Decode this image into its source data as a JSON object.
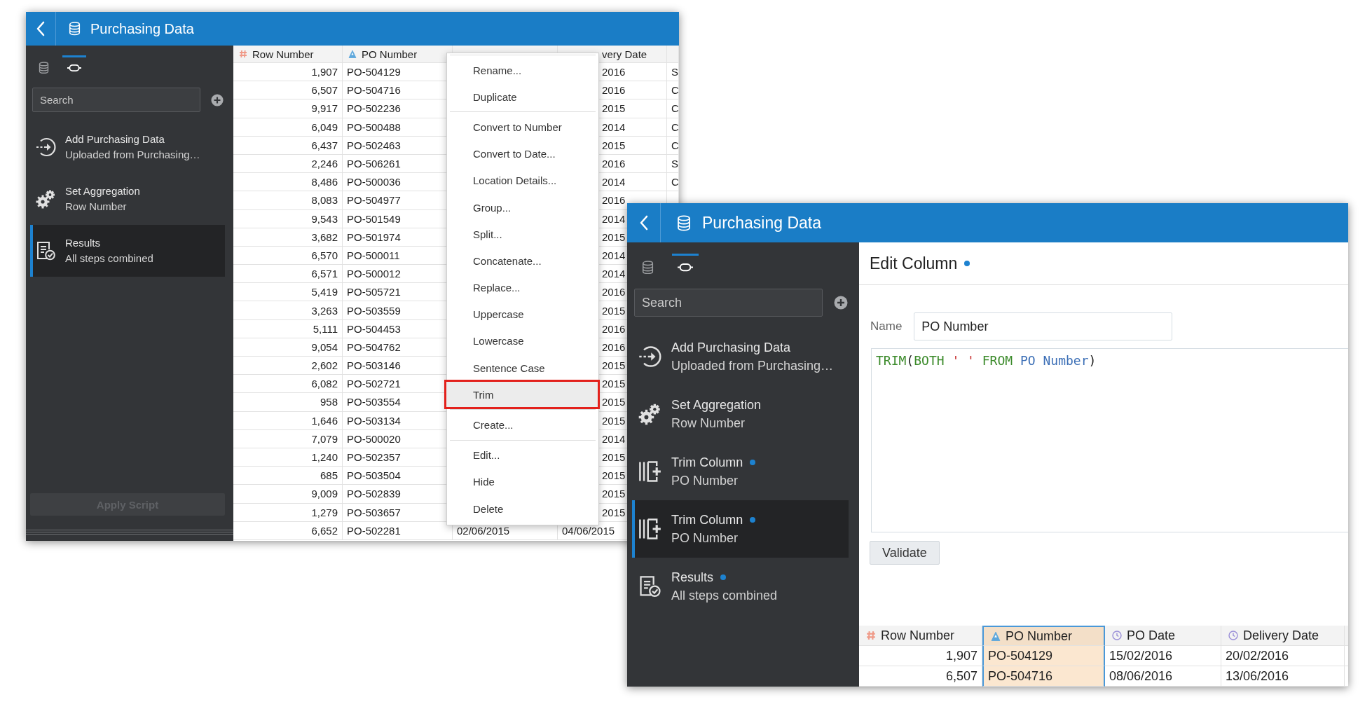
{
  "windows": [
    {
      "title": "Purchasing Data",
      "sidebar": {
        "tabs": [
          {
            "kind": "sources",
            "selected": false
          },
          {
            "kind": "script",
            "selected": true
          }
        ],
        "search": {
          "placeholder": "Search"
        },
        "steps": [
          {
            "kind": "add",
            "title": "Add Purchasing Data",
            "subtitle": "Uploaded from Purchasing…",
            "selected": false,
            "unsaved": false
          },
          {
            "kind": "aggregate",
            "title": "Set Aggregation",
            "subtitle": "Row Number",
            "selected": false,
            "unsaved": false
          },
          {
            "kind": "results",
            "title": "Results",
            "subtitle": "All steps combined",
            "selected": true,
            "unsaved": false
          }
        ],
        "apply_button": {
          "label": "Apply Script",
          "disabled": true
        }
      },
      "table": {
        "columns": [
          {
            "label": "Row Number",
            "kind": "number",
            "selected": false
          },
          {
            "label": "PO Number",
            "kind": "text",
            "selected": false
          },
          {
            "label": "very Date",
            "covered": true,
            "selected": false
          }
        ],
        "rows": [
          {
            "row_number": "1,907",
            "po_number": "PO-504129",
            "delivery_date": "2016",
            "column_5": "S",
            "covered": true
          },
          {
            "row_number": "6,507",
            "po_number": "PO-504716",
            "delivery_date": "2016",
            "column_5": "C",
            "covered": true
          },
          {
            "row_number": "9,917",
            "po_number": "PO-502236",
            "delivery_date": "2015",
            "column_5": "C",
            "covered": true
          },
          {
            "row_number": "6,049",
            "po_number": "PO-500488",
            "delivery_date": "2014",
            "column_5": "C",
            "covered": true
          },
          {
            "row_number": "6,437",
            "po_number": "PO-502463",
            "delivery_date": "2015",
            "column_5": "C",
            "covered": true
          },
          {
            "row_number": "2,246",
            "po_number": "PO-506261",
            "delivery_date": "2016",
            "column_5": "S",
            "covered": true
          },
          {
            "row_number": "8,486",
            "po_number": "PO-500036",
            "delivery_date": "2014",
            "column_5": "C",
            "covered": true
          },
          {
            "row_number": "8,083",
            "po_number": "PO-504977",
            "delivery_date": "2016",
            "covered": true
          },
          {
            "row_number": "9,543",
            "po_number": "PO-501549",
            "delivery_date": "2014",
            "covered": true
          },
          {
            "row_number": "3,682",
            "po_number": "PO-501974",
            "delivery_date": "2015",
            "covered": true
          },
          {
            "row_number": "6,570",
            "po_number": "PO-500011",
            "delivery_date": "2014",
            "covered": true
          },
          {
            "row_number": "6,571",
            "po_number": "PO-500012",
            "delivery_date": "2014",
            "covered": true
          },
          {
            "row_number": "5,419",
            "po_number": "PO-505721",
            "delivery_date": "2016",
            "covered": true
          },
          {
            "row_number": "3,263",
            "po_number": "PO-503559",
            "delivery_date": "2015",
            "covered": true
          },
          {
            "row_number": "5,111",
            "po_number": "PO-504453",
            "delivery_date": "2016",
            "covered": true
          },
          {
            "row_number": "9,054",
            "po_number": "PO-504762",
            "delivery_date": "2016",
            "covered": true
          },
          {
            "row_number": "2,602",
            "po_number": "PO-503146",
            "delivery_date": "2015",
            "covered": true
          },
          {
            "row_number": "6,082",
            "po_number": "PO-502721",
            "delivery_date": "2015",
            "covered": true
          },
          {
            "row_number": "958",
            "po_number": "PO-503554",
            "delivery_date": "2015",
            "covered": true
          },
          {
            "row_number": "1,646",
            "po_number": "PO-503134",
            "delivery_date": "2015",
            "covered": true
          },
          {
            "row_number": "7,079",
            "po_number": "PO-500020",
            "delivery_date": "2014",
            "covered": true
          },
          {
            "row_number": "1,240",
            "po_number": "PO-502357",
            "delivery_date": "2015",
            "covered": true
          },
          {
            "row_number": "685",
            "po_number": "PO-503504",
            "delivery_date": "2015",
            "covered": true
          },
          {
            "row_number": "9,009",
            "po_number": "PO-502839",
            "delivery_date": "2015",
            "covered": true
          },
          {
            "row_number": "1,279",
            "po_number": "PO-503657",
            "delivery_date": "2015",
            "covered": true
          },
          {
            "row_number": "6,652",
            "po_number": "PO-502281",
            "po_date": "02/06/2015",
            "delivery_date": "04/06/2015",
            "covered": false
          }
        ]
      },
      "context_menu": {
        "groups": [
          [
            {
              "label": "Rename...",
              "selected": false
            },
            {
              "label": "Duplicate",
              "selected": false
            }
          ],
          [
            {
              "label": "Convert to Number",
              "selected": false
            },
            {
              "label": "Convert to Date...",
              "selected": false
            },
            {
              "label": "Location Details...",
              "selected": false
            },
            {
              "label": "Group...",
              "selected": false
            },
            {
              "label": "Split...",
              "selected": false
            },
            {
              "label": "Concatenate...",
              "selected": false
            },
            {
              "label": "Replace...",
              "selected": false
            },
            {
              "label": "Uppercase",
              "selected": false
            },
            {
              "label": "Lowercase",
              "selected": false
            },
            {
              "label": "Sentence Case",
              "selected": false
            },
            {
              "label": "Trim",
              "selected": true
            }
          ],
          [
            {
              "label": "Create...",
              "selected": false
            }
          ],
          [
            {
              "label": "Edit...",
              "selected": false
            },
            {
              "label": "Hide",
              "selected": false
            },
            {
              "label": "Delete",
              "selected": false
            }
          ]
        ]
      }
    },
    {
      "title": "Purchasing Data",
      "sidebar": {
        "tabs": [
          {
            "kind": "sources",
            "selected": false
          },
          {
            "kind": "script",
            "selected": true
          }
        ],
        "search": {
          "placeholder": "Search"
        },
        "steps": [
          {
            "kind": "add",
            "title": "Add Purchasing Data",
            "subtitle": "Uploaded from Purchasing…",
            "selected": false,
            "unsaved": false
          },
          {
            "kind": "aggregate",
            "title": "Set Aggregation",
            "subtitle": "Row Number",
            "selected": false,
            "unsaved": false
          },
          {
            "kind": "trim",
            "title": "Trim Column",
            "subtitle": "PO Number",
            "selected": false,
            "unsaved": true
          },
          {
            "kind": "trim",
            "title": "Trim Column",
            "subtitle": "PO Number",
            "selected": true,
            "unsaved": true
          },
          {
            "kind": "results",
            "title": "Results",
            "subtitle": "All steps combined",
            "selected": false,
            "unsaved": true
          }
        ]
      },
      "editor": {
        "title": "Edit Column",
        "unsaved": true,
        "name_label": "Name",
        "name_value": "PO Number",
        "expression": [
          {
            "text": "TRIM",
            "kind": "keyword"
          },
          {
            "text": "(",
            "kind": "plain"
          },
          {
            "text": "BOTH",
            "kind": "keyword"
          },
          {
            "text": " ' '",
            "kind": "string"
          },
          {
            "text": " FROM",
            "kind": "keyword"
          },
          {
            "text": " PO Number",
            "kind": "column"
          },
          {
            "text": ")",
            "kind": "plain"
          }
        ],
        "validate_button": "Validate"
      },
      "table": {
        "columns": [
          {
            "label": "Row Number",
            "kind": "number",
            "selected": false
          },
          {
            "label": "PO Number",
            "kind": "text",
            "selected": true
          },
          {
            "label": "PO Date",
            "kind": "date",
            "selected": false
          },
          {
            "label": "Delivery Date",
            "kind": "date",
            "selected": false
          }
        ],
        "rows": [
          {
            "row_number": "1,907",
            "po_number": "PO-504129",
            "po_date": "15/02/2016",
            "delivery_date": "20/02/2016",
            "covered": false
          },
          {
            "row_number": "6,507",
            "po_number": "PO-504716",
            "po_date": "08/06/2016",
            "delivery_date": "13/06/2016",
            "covered": false
          }
        ]
      }
    }
  ]
}
